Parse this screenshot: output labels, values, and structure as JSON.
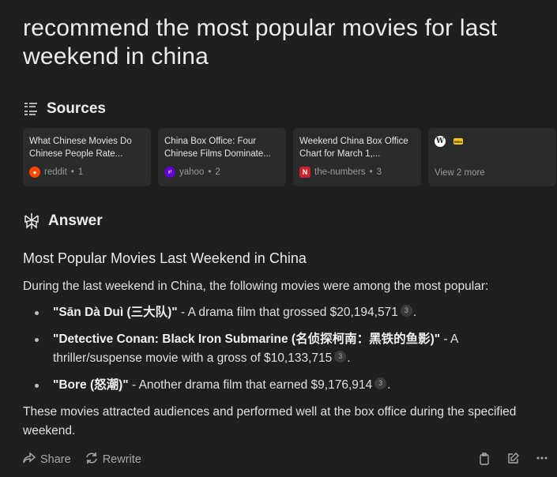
{
  "query": "recommend the most popular movies for last weekend in china",
  "sources": {
    "heading": "Sources",
    "cards": [
      {
        "title": "What Chinese Movies Do Chinese People Rate...",
        "site": "reddit",
        "index": "1",
        "favicon": "reddit-icon"
      },
      {
        "title": "China Box Office: Four Chinese Films Dominate...",
        "site": "yahoo",
        "index": "2",
        "favicon": "yahoo-icon"
      },
      {
        "title": "Weekend China Box Office Chart for March 1,...",
        "site": "the-numbers",
        "index": "3",
        "favicon": "the-numbers-icon"
      }
    ],
    "more": {
      "label": "View 2 more",
      "favicons": [
        "wikipedia-icon",
        "imdb-icon"
      ]
    }
  },
  "answer": {
    "heading": "Answer",
    "title": "Most Popular Movies Last Weekend in China",
    "intro": "During the last weekend in China, the following movies were among the most popular:",
    "movies": [
      {
        "name": "\"Sān Dà Duì (三大队)\"",
        "desc": " - A drama film that grossed $20,194,571",
        "cite": "3",
        "end": "."
      },
      {
        "name": "\"Detective Conan: Black Iron Submarine (名侦探柯南：黑铁的鱼影)\"",
        "desc": " - A thriller/suspense movie with a gross of $10,133,715",
        "cite": "3",
        "end": "."
      },
      {
        "name": "\"Bore (怒潮)\"",
        "desc": " - Another drama film that earned $9,176,914",
        "cite": "3",
        "end": "."
      }
    ],
    "outro": "These movies attracted audiences and performed well at the box office during the specified weekend."
  },
  "actions": {
    "share": "Share",
    "rewrite": "Rewrite"
  },
  "icons": {
    "accent": "#ff4500",
    "yahoo": "#6001d2",
    "numbers": "#d0202a",
    "imdb": "#f5c518"
  }
}
